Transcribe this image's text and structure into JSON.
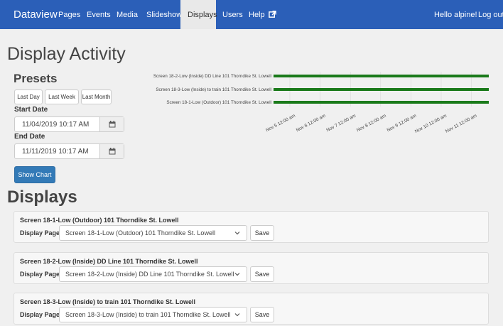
{
  "navbar": {
    "brand": "Dataview",
    "items": [
      "Pages",
      "Events",
      "Media",
      "Slideshows",
      "Displays",
      "Users",
      "Help"
    ],
    "active": "Displays",
    "greeting": "Hello alpine!",
    "logout": "Log out",
    "color": "#2b5fb8"
  },
  "page_title": "Display Activity",
  "presets": {
    "title": "Presets",
    "buttons": [
      "Last Day",
      "Last Week",
      "Last Month"
    ]
  },
  "start_date": {
    "label": "Start Date",
    "value": "11/04/2019 10:17 AM"
  },
  "end_date": {
    "label": "End Date",
    "value": "11/11/2019 10:17 AM"
  },
  "show_chart": "Show Chart",
  "chart": {
    "series": [
      {
        "name": "Screen 18-2-Low (Inside) DD Line 101 Thorndike St. Lowell"
      },
      {
        "name": "Screen 18-3-Low (Inside) to train 101 Thorndike St. Lowell"
      },
      {
        "name": "Screen 18-1-Low (Outdoor) 101 Thorndike St. Lowell"
      }
    ],
    "ticks": [
      "Nov 5 12:00 am",
      "Nov 6 12:00 am",
      "Nov 7 12:00 am",
      "Nov 8 12:00 am",
      "Nov 9 12:00 am",
      "Nov 10 12:00 am",
      "Nov 11 12:00 am"
    ],
    "bar_color": "#1a7a1a"
  },
  "displays_title": "Displays",
  "displays": [
    {
      "name": "Screen 18-1-Low (Outdoor) 101 Thorndike St. Lowell",
      "label": "Display Page:",
      "page": "Screen 18-1-Low (Outdoor) 101 Thorndike St. Lowell",
      "save": "Save"
    },
    {
      "name": "Screen 18-2-Low (Inside) DD Line 101 Thorndike St. Lowell",
      "label": "Display Page:",
      "page": "Screen 18-2-Low (Inside) DD Line 101 Thorndike St. Lowell",
      "save": "Save"
    },
    {
      "name": "Screen 18-3-Low (Inside) to train 101 Thorndike St. Lowell",
      "label": "Display Page:",
      "page": "Screen 18-3-Low (Inside) to train 101 Thorndike St. Lowell",
      "save": "Save"
    }
  ]
}
